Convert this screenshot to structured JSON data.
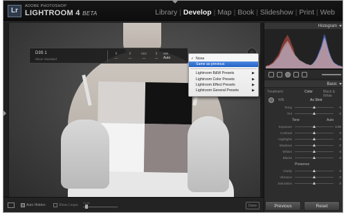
{
  "app": {
    "logo_text": "Lr",
    "brand_sub": "ADOBE PHOTOSHOP",
    "brand_main": "LIGHTROOM 4",
    "brand_beta": "BETA"
  },
  "modules": [
    {
      "label": "Library",
      "active": false
    },
    {
      "label": "Develop",
      "active": true
    },
    {
      "label": "Map",
      "active": false
    },
    {
      "label": "Book",
      "active": false
    },
    {
      "label": "Slideshow",
      "active": false
    },
    {
      "label": "Print",
      "active": false
    },
    {
      "label": "Web",
      "active": false
    }
  ],
  "hud": {
    "camera": "D3S 1",
    "profile": "Nikon Standard",
    "columns": [
      {
        "label": "f/",
        "value": "—"
      },
      {
        "label": "f/",
        "value": "—"
      },
      {
        "label": "ISO",
        "value": "—"
      },
      {
        "label": "f/",
        "value": "—"
      }
    ],
    "wb_label": "WB",
    "wb_value": "Auto"
  },
  "menu": {
    "items": [
      {
        "label": "None",
        "checked": true,
        "highlighted": false,
        "submenu": false
      },
      {
        "label": "Same as previous",
        "checked": false,
        "highlighted": true,
        "submenu": false
      },
      {
        "separator": true
      },
      {
        "label": "Lightroom B&W Presets",
        "checked": false,
        "highlighted": false,
        "submenu": true
      },
      {
        "label": "Lightroom Color Presets",
        "checked": false,
        "highlighted": false,
        "submenu": true
      },
      {
        "label": "Lightroom Effect Presets",
        "checked": false,
        "highlighted": false,
        "submenu": true
      },
      {
        "label": "Lightroom General Presets",
        "checked": false,
        "highlighted": false,
        "submenu": true
      }
    ]
  },
  "right_panel": {
    "histogram_title": "Histogram",
    "basic_title": "Basic",
    "treatment_label": "Treatment:",
    "treatment_color": "Color",
    "treatment_bw": "Black & White",
    "wb_label": "WB:",
    "wb_value": "As Shot",
    "wb_sliders": [
      {
        "label": "Temp",
        "value": "0",
        "pos": 0.5
      },
      {
        "label": "Tint",
        "value": "0",
        "pos": 0.5
      }
    ],
    "tone_title": "Tone",
    "tone_auto": "Auto",
    "tone_sliders": [
      {
        "label": "Exposure",
        "value": "0.00",
        "pos": 0.5
      },
      {
        "label": "Contrast",
        "value": "0",
        "pos": 0.5
      },
      {
        "label": "Highlights",
        "value": "0",
        "pos": 0.5
      },
      {
        "label": "Shadows",
        "value": "0",
        "pos": 0.5
      },
      {
        "label": "Whites",
        "value": "0",
        "pos": 0.5
      },
      {
        "label": "Blacks",
        "value": "0",
        "pos": 0.5
      }
    ],
    "presence_title": "Presence",
    "presence_sliders": [
      {
        "label": "Clarity",
        "value": "0",
        "pos": 0.5
      },
      {
        "label": "Vibrance",
        "value": "0",
        "pos": 0.5
      },
      {
        "label": "Saturation",
        "value": "0",
        "pos": 0.5
      }
    ]
  },
  "bottom_bar": {
    "auto_label": "Auto Hidden",
    "loupe_label": "Show Loupe",
    "zoom_label": "Scale",
    "done_label": "Done"
  },
  "buttons": {
    "previous": "Previous",
    "reset": "Reset"
  },
  "histogram_bins": [
    2,
    3,
    3,
    4,
    5,
    6,
    8,
    10,
    12,
    14,
    18,
    22,
    25,
    28,
    30,
    32,
    29,
    26,
    22,
    19,
    16,
    14,
    12,
    10,
    9,
    8,
    7,
    6,
    5,
    5,
    4,
    4,
    5,
    7,
    9,
    12,
    16,
    20,
    24,
    30,
    36,
    33,
    26,
    20,
    15,
    11,
    8,
    6,
    5,
    4,
    3,
    3,
    2,
    2
  ]
}
